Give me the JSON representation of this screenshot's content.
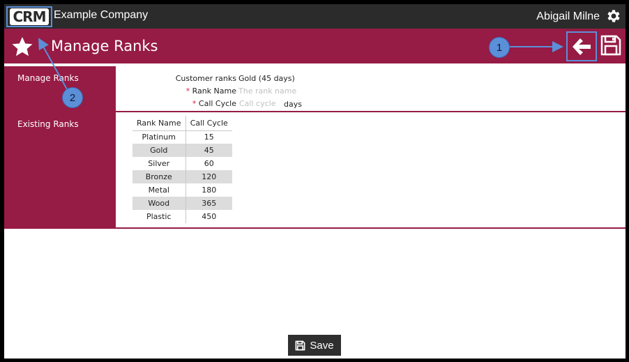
{
  "header": {
    "logo_text": "CRM",
    "company": "Example Company",
    "user": "Abigail Milne"
  },
  "title_bar": {
    "title": "Manage Ranks",
    "back_icon": "arrow-left-icon",
    "save_icon": "floppy-disk-icon"
  },
  "manage_section": {
    "label": "Manage Ranks",
    "fields": {
      "customer_ranks_label": "Customer ranks",
      "customer_ranks_value": "Gold (45 days)",
      "rank_name_required": "*",
      "rank_name_label": "Rank Name",
      "rank_name_placeholder": "The rank name",
      "call_cycle_required": "*",
      "call_cycle_label": "Call Cycle",
      "call_cycle_placeholder": "Call cycle",
      "call_cycle_unit": "days"
    }
  },
  "existing_section": {
    "label": "Existing Ranks",
    "columns": [
      "Rank Name",
      "Call Cycle"
    ],
    "rows": [
      [
        "Platinum",
        "15"
      ],
      [
        "Gold",
        "45"
      ],
      [
        "Silver",
        "60"
      ],
      [
        "Bronze",
        "120"
      ],
      [
        "Metal",
        "180"
      ],
      [
        "Wood",
        "365"
      ],
      [
        "Plastic",
        "450"
      ]
    ]
  },
  "footer": {
    "save_label": "Save"
  },
  "annotations": {
    "callout_1": "1",
    "callout_2": "2"
  },
  "colors": {
    "brand": "#961b45",
    "topbar": "#2b2b2b",
    "highlight": "#5b8fd8"
  }
}
